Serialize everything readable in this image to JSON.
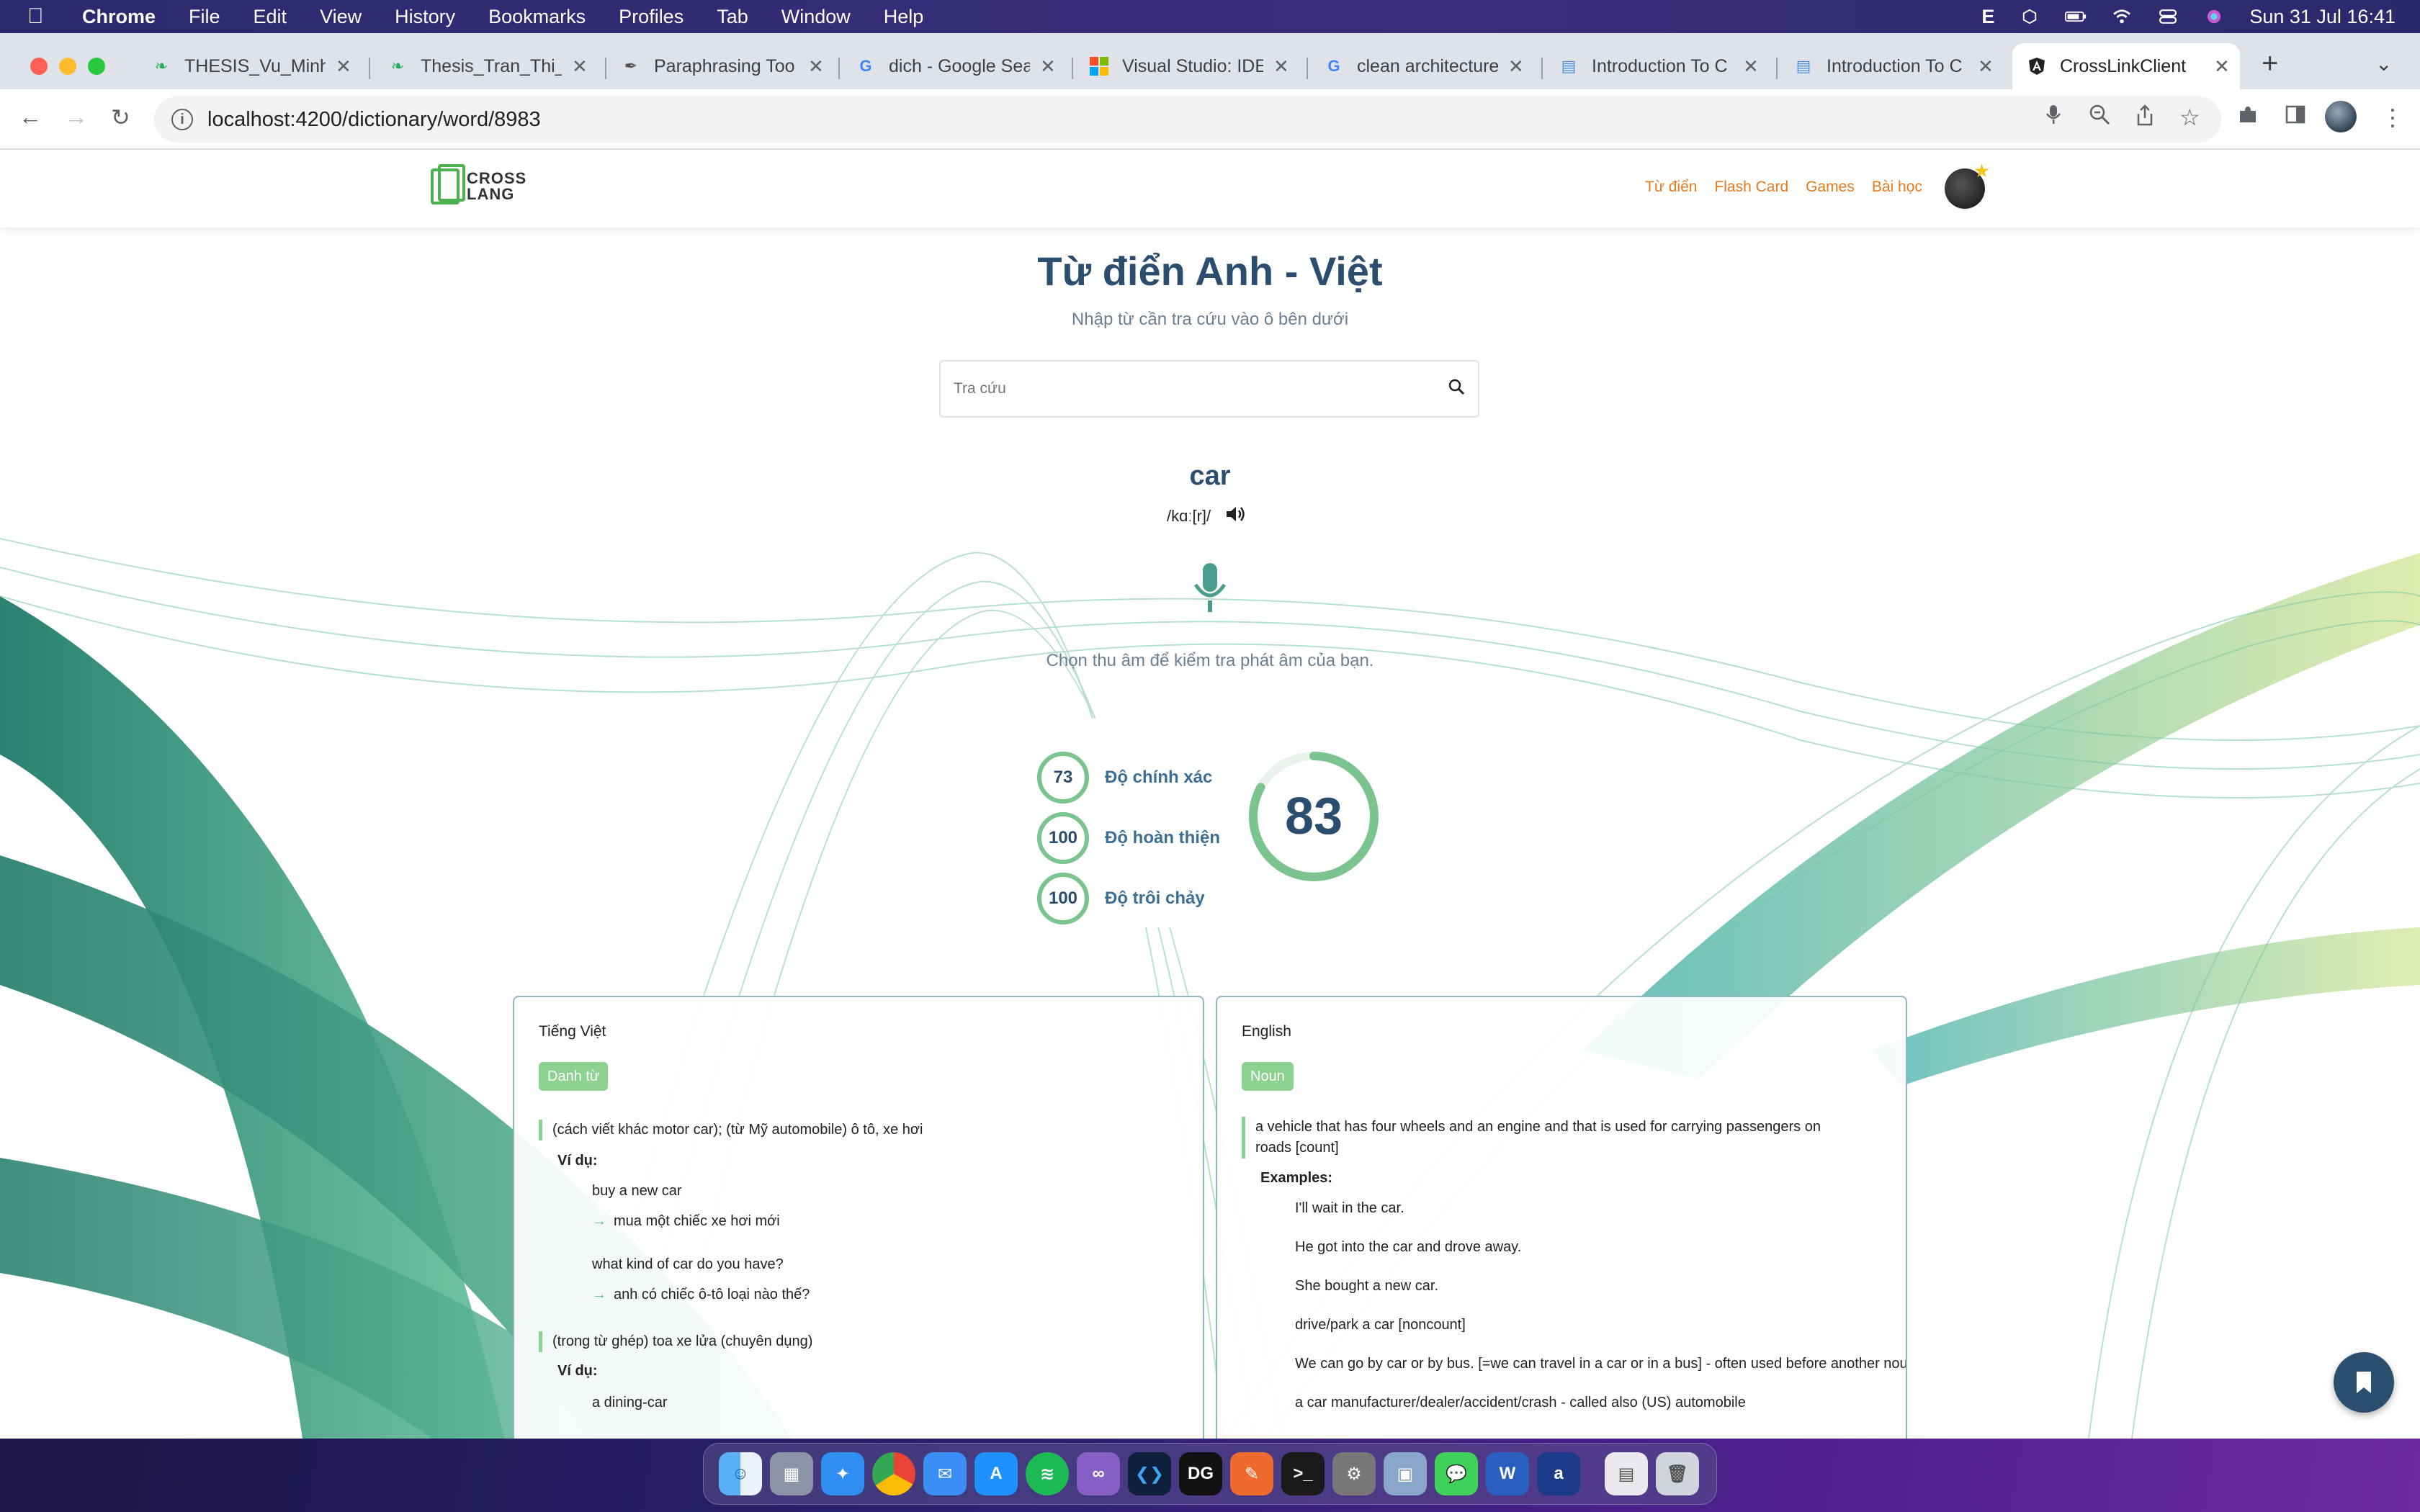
{
  "menubar": {
    "app": "Chrome",
    "items": [
      "File",
      "Edit",
      "View",
      "History",
      "Bookmarks",
      "Profiles",
      "Tab",
      "Window",
      "Help"
    ],
    "status_e": "E",
    "datetime": "Sun 31 Jul  16:41"
  },
  "tabs": [
    {
      "label": "THESIS_Vu_Minh",
      "icon": "leaf-icon",
      "color": "#27ae60"
    },
    {
      "label": "Thesis_Tran_Thi_",
      "icon": "leaf-icon",
      "color": "#27ae60"
    },
    {
      "label": "Paraphrasing Too",
      "icon": "feather-icon",
      "color": "#555555"
    },
    {
      "label": "dich - Google Sea",
      "icon": "google-icon",
      "color": "#4285f4"
    },
    {
      "label": "Visual Studio: IDE",
      "icon": "windows-icon",
      "color": "#f25022"
    },
    {
      "label": "clean architecture",
      "icon": "google-icon",
      "color": "#4285f4"
    },
    {
      "label": "Introduction To C",
      "icon": "doc-icon",
      "color": "#4a90d9"
    },
    {
      "label": "Introduction To C",
      "icon": "doc-icon",
      "color": "#4a90d9"
    },
    {
      "label": "CrossLinkClient",
      "icon": "angular-icon",
      "color": "#222222"
    }
  ],
  "address": {
    "url": "localhost:4200/dictionary/word/8983"
  },
  "site": {
    "logo_line1": "CROSS",
    "logo_line2": "LANG",
    "nav": [
      "Từ điển",
      "Flash Card",
      "Games",
      "Bài học"
    ]
  },
  "page": {
    "title": "Từ điển Anh - Việt",
    "subtitle": "Nhập từ cần tra cứu vào ô bên dưới",
    "search_placeholder": "Tra cứu"
  },
  "word": {
    "text": "car",
    "phonetic": "/kɑː[r]/",
    "record_hint": "Chọn thu âm để kiểm tra phát âm của bạn."
  },
  "scores": {
    "items": [
      {
        "value": "73",
        "label": "Độ chính xác"
      },
      {
        "value": "100",
        "label": "Độ hoàn thiện"
      },
      {
        "value": "100",
        "label": "Độ trôi chảy"
      }
    ],
    "overall": "83",
    "overall_fraction": 0.83
  },
  "vietnamese": {
    "title": "Tiếng Việt",
    "pos": "Danh từ",
    "example_label": "Ví dụ:",
    "senses": [
      {
        "def": "(cách viết khác motor car); (từ Mỹ automobile) ô tô, xe hơi",
        "examples": [
          {
            "en": "buy a new car",
            "vi": "mua một chiếc xe hơi mới"
          },
          {
            "en": "what kind of car do you have?",
            "vi": "anh có chiếc ô-tô loại nào thế?"
          }
        ]
      },
      {
        "def": "(trong từ ghép) toa xe lửa (chuyên dụng)",
        "examples": [
          {
            "en": "a dining-car",
            "vi": ""
          }
        ]
      }
    ]
  },
  "english": {
    "title": "English",
    "pos": "Noun",
    "example_label": "Examples:",
    "def_line1": "a vehicle that has four wheels and an engine and that is used for carrying passengers on",
    "def_line2": "roads [count]",
    "examples": [
      "I'll wait in the car.",
      "He got into the car and drove away.",
      "She bought a new car.",
      "drive/park a car [noncount]",
      "We can go by car or by bus. [=we can travel in a car or in a bus] - often used before another noun",
      "a car manufacturer/dealer/accident/crash - called also (US) automobile"
    ]
  },
  "colors": {
    "accent": "#2c4e6e",
    "nav_link": "#e8791d",
    "score_ring": "#7cc48f",
    "pos_badge": "#8bd38f"
  }
}
